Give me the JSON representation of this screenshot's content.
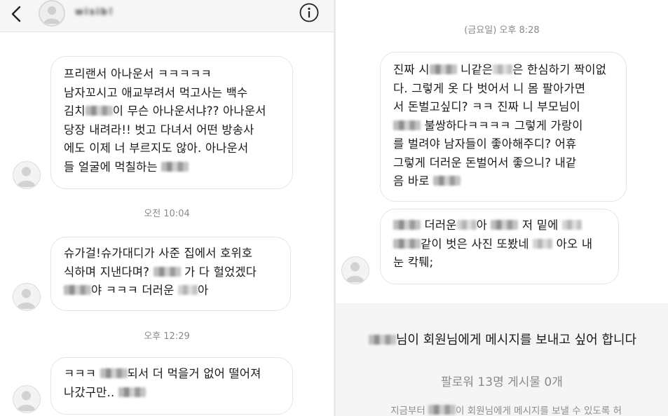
{
  "left_panel": {
    "header": {
      "back_icon": "chevron-left-icon",
      "username": "wisib!",
      "info_icon": "info-circle-icon"
    },
    "messages": [
      {
        "lines": [
          "프리랜서 아나운서 ㅋㅋㅋㅋㅋ",
          "남자꼬시고 애교부려서 먹고사는 백수",
          "김치░이 무슨 아나운서냐?? 아나운서",
          "당장 내려라!! 벗고 다녀서 어떤 방송사",
          "에도 이제 너 부르지도 않아. 아나운서",
          "들 얼굴에 먹칠하는 ░"
        ]
      },
      {
        "lines": [
          "슈가걸!슈가대디가 사준 집에서 호위호",
          "식하며 지낸다며? ░ 가 다 헐었겠다",
          "░야 ㅋㅋㅋ 더러운 ░아"
        ]
      },
      {
        "lines": [
          "ㅋㅋㅋ ░되서 더 먹을거 없어 떨어져",
          "나갔구만.. ░"
        ]
      }
    ],
    "timestamps": [
      "오전 10:04",
      "오후 12:29"
    ]
  },
  "right_panel": {
    "timestamp": "(금요일) 오후 8:28",
    "messages": [
      {
        "lines": [
          "진짜 시░ 니같은░은 한심하기 짝이없",
          "다. 그렇게 옷 다 벗어서 니 몸 팔아가면",
          "서 돈벌고싶디? ㅋㅋ 진짜 니 부모님이",
          "░ 불쌍하다ㅋㅋㅋㅋ 그렇게 가랑이",
          "를 벌려야 남자들이 좋아해주디? 어휴",
          "그렇게 더러운 돈벌어서 좋으니? 내같",
          "음 바로 ░"
        ]
      },
      {
        "lines": [
          "░ 더러운░아 ░ 저 밑에 ░",
          "░같이 벗은 사진 또봤네 ░ 아오 내",
          "눈 칵퉤;"
        ]
      }
    ],
    "request": {
      "title": "░님이 회원님에게 메시지를 보내고 싶어 합니다",
      "stats": "팔로워 13명 게시물 0개",
      "note": "지금부터 ░이 회원님에게 메시지를 보낼 수 있도록 허"
    }
  },
  "colors": {
    "bubble_border": "#e4e4e4",
    "timestamp": "#8a8a8a",
    "request_background": "#f5f5f5",
    "text": "#1a1a1a"
  }
}
